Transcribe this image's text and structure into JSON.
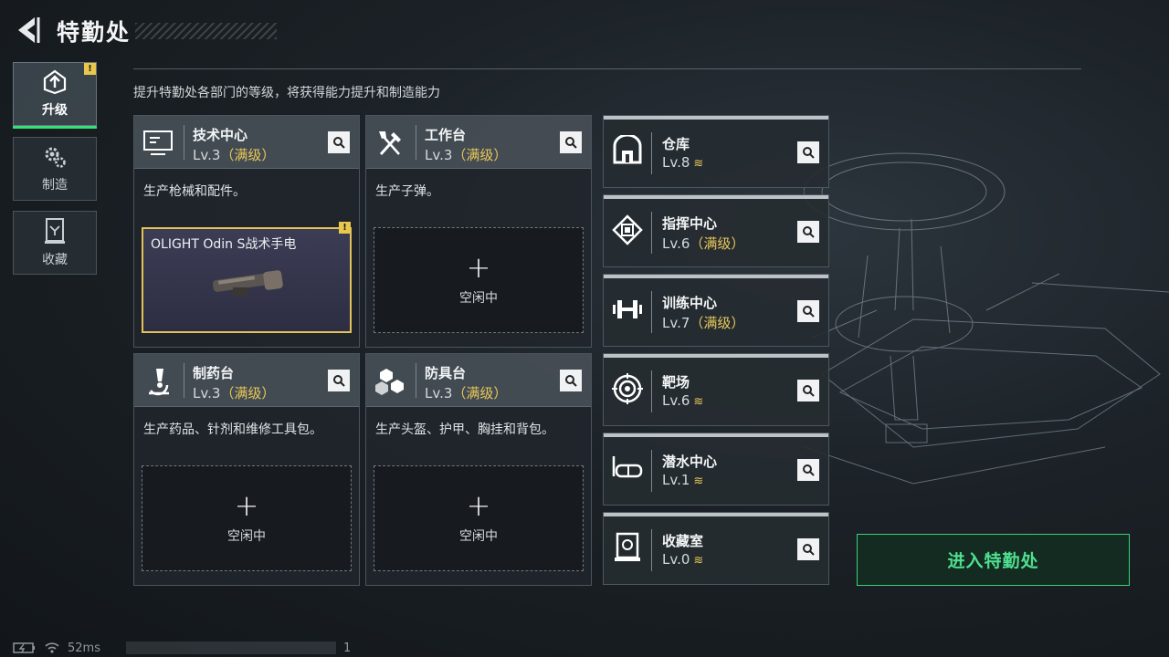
{
  "header": {
    "title": "特勤处"
  },
  "nav": [
    {
      "label": "升级",
      "icon": "upgrade-icon",
      "active": true,
      "badge": "!"
    },
    {
      "label": "制造",
      "icon": "gears-icon",
      "active": false
    },
    {
      "label": "收藏",
      "icon": "collection-icon",
      "active": false
    }
  ],
  "subtitle": "提升特勤处各部门的等级，将获得能力提升和制造能力",
  "departments": [
    {
      "name": "技术中心",
      "level": "Lv.3",
      "max": "（满级）",
      "desc": "生产枪械和配件。",
      "icon": "monitor-icon",
      "slot": {
        "state": "busy",
        "item_name": "OLIGHT Odin S战术手电",
        "badge": "!"
      }
    },
    {
      "name": "工作台",
      "level": "Lv.3",
      "max": "（满级）",
      "desc": "生产子弹。",
      "icon": "tools-icon",
      "slot": {
        "state": "idle",
        "plus": "+",
        "text": "空闲中"
      }
    },
    {
      "name": "制药台",
      "level": "Lv.3",
      "max": "（满级）",
      "desc": "生产药品、针剂和维修工具包。",
      "icon": "microscope-icon",
      "slot": {
        "state": "idle",
        "plus": "+",
        "text": "空闲中"
      }
    },
    {
      "name": "防具台",
      "level": "Lv.3",
      "max": "（满级）",
      "desc": "生产头盔、护甲、胸挂和背包。",
      "icon": "armor-cubes-icon",
      "slot": {
        "state": "idle",
        "plus": "+",
        "text": "空闲中"
      }
    }
  ],
  "facilities": [
    {
      "name": "仓库",
      "level": "Lv.8",
      "max": "",
      "upgradable": true,
      "icon": "warehouse-icon"
    },
    {
      "name": "指挥中心",
      "level": "Lv.6",
      "max": "（满级）",
      "upgradable": false,
      "icon": "chip-icon"
    },
    {
      "name": "训练中心",
      "level": "Lv.7",
      "max": "（满级）",
      "upgradable": false,
      "icon": "dumbbell-icon"
    },
    {
      "name": "靶场",
      "level": "Lv.6",
      "max": "",
      "upgradable": true,
      "icon": "target-icon"
    },
    {
      "name": "潜水中心",
      "level": "Lv.1",
      "max": "",
      "upgradable": true,
      "icon": "diving-mask-icon"
    },
    {
      "name": "收藏室",
      "level": "Lv.0",
      "max": "",
      "upgradable": true,
      "icon": "collection-room-icon"
    }
  ],
  "upgrade_glyph": "≋",
  "enter_button": "进入特勤处",
  "status": {
    "ping": "52ms",
    "counter": "1"
  },
  "colors": {
    "accent_green": "#35e07a",
    "max_gold": "#e8c75a"
  }
}
